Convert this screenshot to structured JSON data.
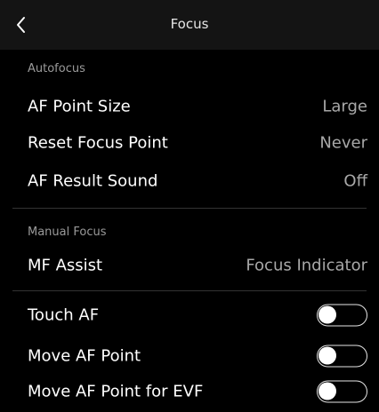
{
  "header": {
    "title": "Focus",
    "back_icon": "chevron-left-icon"
  },
  "sections": {
    "autofocus": {
      "label": "Autofocus",
      "items": [
        {
          "label": "AF Point Size",
          "value": "Large"
        },
        {
          "label": "Reset Focus Point",
          "value": "Never"
        },
        {
          "label": "AF Result Sound",
          "value": "Off"
        }
      ]
    },
    "manual_focus": {
      "label": "Manual Focus",
      "items": [
        {
          "label": "MF Assist",
          "value": "Focus Indicator"
        }
      ]
    },
    "toggles": [
      {
        "label": "Touch AF",
        "state": "off"
      },
      {
        "label": "Move AF Point",
        "state": "off"
      },
      {
        "label": "Move AF Point for EVF",
        "state": "off"
      }
    ]
  },
  "colors": {
    "background": "#000000",
    "header_background": "#141414",
    "primary_text": "#ffffff",
    "secondary_text": "#a8a8a8",
    "section_label": "#9a9a9a",
    "divider": "#333333"
  }
}
